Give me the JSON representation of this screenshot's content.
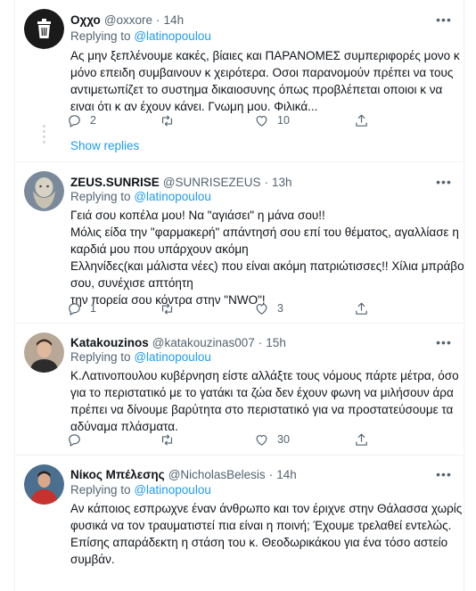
{
  "tweets": [
    {
      "name": "Οχχο",
      "handle": "@oxxore",
      "time": "14h",
      "replying_prefix": "Replying to",
      "replying_to": "@latinopoulou",
      "lines": [
        "Ας μην ξεπλένουμε κακές, βίαιες και ΠΑΡΑΝΟΜΕΣ συμπεριφορές μονο κ",
        "μόνο επειδη συμβαινουν κ χειρότερα. Οσοι παρανομούν πρέπει να τους",
        "αντιμετωπίζετ το συστημα δικαιοσυνης όπως προβλέπεται οποιοι κ να",
        "ειναι ότι κ αν έχουν κάνει. Γνωμη μου. Φιλικά..."
      ],
      "replies": "2",
      "retweets": "",
      "likes": "10"
    },
    {
      "name": "ZEUS.SUNRISE",
      "handle": "@SUNRISEZEUS",
      "time": "13h",
      "replying_prefix": "Replying to",
      "replying_to": "@latinopoulou",
      "lines": [
        "Γειά σου κοπέλα μου! Να \"αγιάσει\" η μάνα σου!!",
        "Μόλις είδα την \"φαρμακερή\" απάντησή σου επί του θέματος, αγαλλίασε η",
        "καρδιά μου που υπάρχουν ακόμη",
        "Ελληνίδες(και μάλιστα νέες) που είναι ακόμη πατριώτισσες!! Χίλια μπράβο",
        "σου, συνέχισε απτόητη",
        "την πορεία σου κόντρα στην \"NWO\"!"
      ],
      "replies": "1",
      "retweets": "",
      "likes": "3"
    },
    {
      "name": "Katakouzinos",
      "handle": "@katakouzinas007",
      "time": "15h",
      "replying_prefix": "Replying to",
      "replying_to": "@latinopoulou",
      "lines": [
        "Κ.Λατινοπουλου κυβέρνηση είστε αλλάξτε τους νόμους πάρτε μέτρα, όσο",
        "για το περιστατικό με το γατάκι τα ζώα δεν έχουν φωνη να μιλήσουν άρα",
        "πρέπει να δίνουμε βαρύτητα  στο περιστατικό για να προστατεύσουμε τα",
        "αδύναμα πλάσματα."
      ],
      "replies": "",
      "retweets": "",
      "likes": "30"
    },
    {
      "name": "Νίκος Μπέλεσης",
      "handle": "@NicholasBelesis",
      "time": "14h",
      "replying_prefix": "Replying to",
      "replying_to": "@latinopoulou",
      "lines": [
        "Αν κάποιος εσπρωχνε έναν άνθρωπο και τον έριχνε στην Θάλασσα χωρίς",
        "φυσικά να τον τραυματιστεί πια είναι η ποινή; Έχουμε τρελαθεί εντελώς.",
        "Επίσης απαράδεκτη η στάση του κ. Θεοδωρικάκου για ένα τόσο αστείο",
        "συμβάν."
      ],
      "replies": "",
      "retweets": "",
      "likes": ""
    }
  ],
  "show_replies": "Show replies",
  "colors": {
    "link": "#1d9bf0",
    "muted": "#536471",
    "text": "#0f1419",
    "divider": "#eff3f4"
  },
  "icons": [
    "more-icon",
    "reply-icon",
    "retweet-icon",
    "like-icon",
    "share-icon"
  ]
}
